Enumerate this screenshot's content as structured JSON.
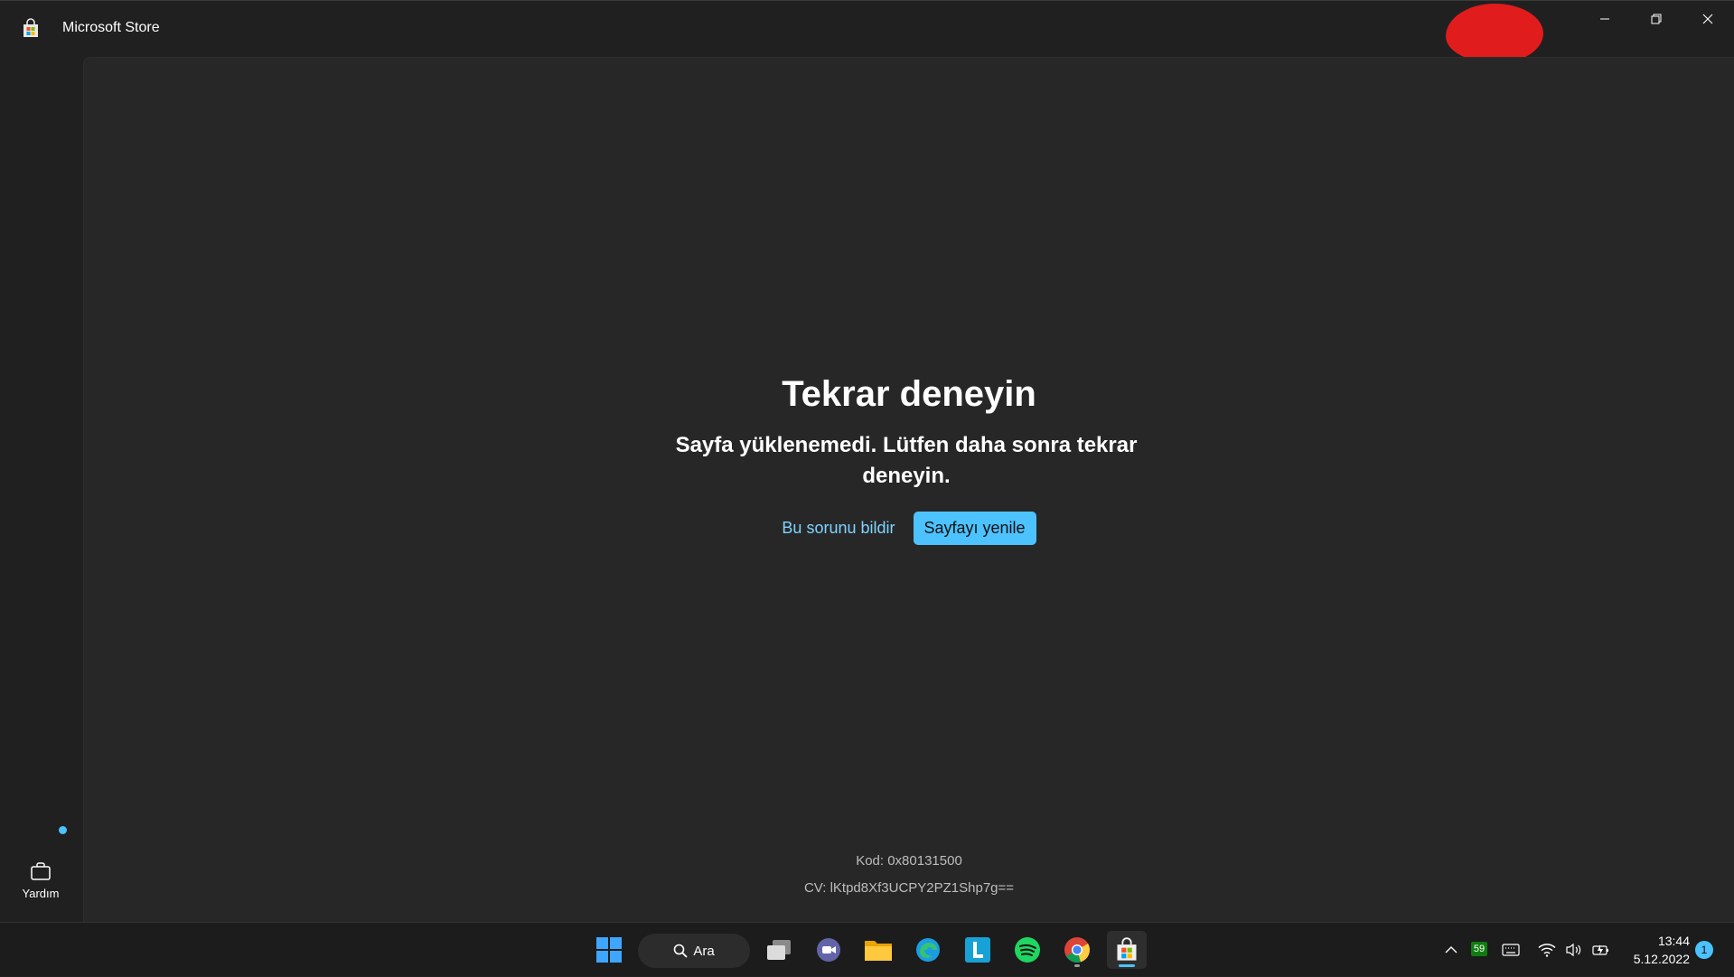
{
  "window": {
    "title": "Microsoft Store",
    "controls": {
      "minimize": "minimize-icon",
      "restore": "restore-icon",
      "close": "close-icon"
    }
  },
  "nav": {
    "help_label": "Yardım",
    "help_has_notification": true
  },
  "error": {
    "title": "Tekrar deneyin",
    "message": "Sayfa yüklenemedi. Lütfen daha sonra tekrar deneyin.",
    "report_label": "Bu sorunu bildir",
    "refresh_label": "Sayfayı yenile",
    "code": "Kod: 0x80131500",
    "cv": "CV: lKtpd8Xf3UCPY2PZ1Shp7g=="
  },
  "taskbar": {
    "search_label": "Ara",
    "apps": [
      "start-icon",
      "search",
      "task-view-icon",
      "teams-chat-icon",
      "file-explorer-icon",
      "edge-icon",
      "l-app-icon",
      "spotify-icon",
      "chrome-icon",
      "microsoft-store-icon"
    ],
    "tray": {
      "battery_badge": "59",
      "time": "13:44",
      "date": "5.12.2022",
      "notifications": "1"
    }
  },
  "colors": {
    "accent": "#4cc2ff",
    "background": "#202020",
    "content": "#272727",
    "taskbar": "#1c1c1c",
    "redaction": "#e01c1c"
  }
}
